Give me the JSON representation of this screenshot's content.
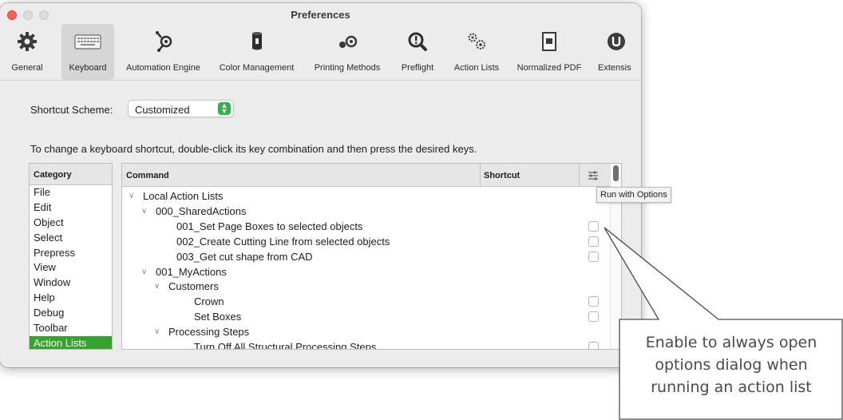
{
  "window": {
    "title": "Preferences"
  },
  "toolbar": {
    "items": [
      {
        "label": "General",
        "icon": "gear-icon"
      },
      {
        "label": "Keyboard",
        "icon": "keyboard-icon"
      },
      {
        "label": "Automation Engine",
        "icon": "automation-engine-icon"
      },
      {
        "label": "Color Management",
        "icon": "color-management-icon"
      },
      {
        "label": "Printing Methods",
        "icon": "printing-methods-icon"
      },
      {
        "label": "Preflight",
        "icon": "preflight-icon"
      },
      {
        "label": "Action Lists",
        "icon": "action-lists-icon"
      },
      {
        "label": "Normalized PDF",
        "icon": "normalized-pdf-icon"
      },
      {
        "label": "Extensis",
        "icon": "extensis-icon"
      }
    ],
    "selected": "Keyboard"
  },
  "scheme": {
    "label": "Shortcut Scheme:",
    "value": "Customized"
  },
  "instruction": "To change a keyboard shortcut, double-click its key combination and then press the desired keys.",
  "category": {
    "header": "Category",
    "items": [
      "File",
      "Edit",
      "Object",
      "Select",
      "Prepress",
      "View",
      "Window",
      "Help",
      "Debug",
      "Toolbar",
      "Action Lists"
    ],
    "selected": "Action Lists",
    "selected_color": "#36a32e"
  },
  "commands": {
    "headers": {
      "command": "Command",
      "shortcut": "Shortcut"
    },
    "rows": [
      {
        "label": "Local Action Lists",
        "expandable": true,
        "checkbox": false
      },
      {
        "label": "000_SharedActions",
        "expandable": true,
        "checkbox": false
      },
      {
        "label": "001_Set Page Boxes to selected objects",
        "expandable": false,
        "checkbox": true
      },
      {
        "label": "002_Create Cutting Line from selected objects",
        "expandable": false,
        "checkbox": true
      },
      {
        "label": "003_Get cut shape from CAD",
        "expandable": false,
        "checkbox": true
      },
      {
        "label": "001_MyActions",
        "expandable": true,
        "checkbox": false
      },
      {
        "label": "Customers",
        "expandable": true,
        "checkbox": false
      },
      {
        "label": "Crown",
        "expandable": false,
        "checkbox": true
      },
      {
        "label": "Set Boxes",
        "expandable": false,
        "checkbox": true
      },
      {
        "label": "Processing Steps",
        "expandable": true,
        "checkbox": false
      },
      {
        "label": "Turn Off All Structural Processing Steps",
        "expandable": false,
        "checkbox": true
      }
    ]
  },
  "tooltip": "Run with Options",
  "callout": {
    "line1": "Enable to always open",
    "line2": "options dialog when",
    "line3": "running an action list"
  }
}
